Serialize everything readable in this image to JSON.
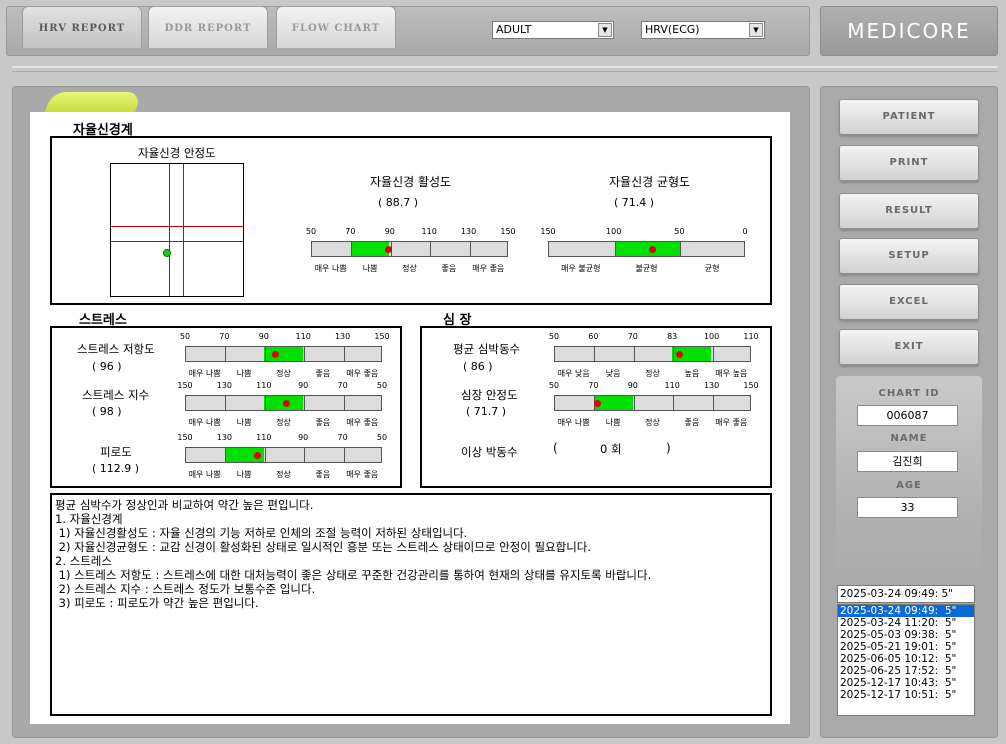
{
  "tabs": [
    {
      "label": "HRV  REPORT"
    },
    {
      "label": "DDR REPORT"
    },
    {
      "label": "FLOW  CHART"
    }
  ],
  "selects": {
    "population": "ADULT",
    "mode": "HRV(ECG)"
  },
  "brand": "MEDICORE",
  "autonomic": {
    "title": "자율신경계",
    "stability_title": "자율신경 안정도",
    "activity": {
      "title": "자율신경 활성도",
      "value_text": "(     88.7     )",
      "value": 88.7,
      "ticks": [
        "50",
        "70",
        "90",
        "110",
        "130",
        "150"
      ],
      "labels": [
        "매우 나쁨",
        "나쁨",
        "정상",
        "좋음",
        "매우 좋음"
      ]
    },
    "balance": {
      "title": "자율신경 균형도",
      "value_text": "(     71.4     )",
      "value": 71.4,
      "ticks": [
        "150",
        "100",
        "50",
        "0"
      ],
      "labels": [
        "매우 불균형",
        "불균형",
        "균형"
      ]
    }
  },
  "stress": {
    "title": "스트레스",
    "resistance": {
      "label": "스트레스 저항도",
      "value_text": "(     96     )",
      "value": 96,
      "ticks": [
        "50",
        "70",
        "90",
        "110",
        "130",
        "150"
      ],
      "labels": [
        "매우 나쁨",
        "나쁨",
        "정상",
        "좋음",
        "매우 좋음"
      ]
    },
    "index": {
      "label": "스트레스 지수",
      "value_text": "(     98     )",
      "value": 98,
      "ticks": [
        "150",
        "130",
        "110",
        "90",
        "70",
        "50"
      ],
      "labels": [
        "매우 나쁨",
        "나쁨",
        "정상",
        "좋음",
        "매우 좋음"
      ]
    },
    "fatigue": {
      "label": "피로도",
      "value_text": "( 112.9  )",
      "value": 112.9,
      "ticks": [
        "150",
        "130",
        "110",
        "90",
        "70",
        "50"
      ],
      "labels": [
        "매우 나쁨",
        "나쁨",
        "정상",
        "좋음",
        "매우 좋음"
      ]
    }
  },
  "heart": {
    "title": "심  장",
    "avg_hr": {
      "label": "평균 심박동수",
      "value_text": "(     86     )",
      "value": 86,
      "ticks": [
        "50",
        "60",
        "70",
        "83",
        "100",
        "110"
      ],
      "labels": [
        "매우 낮음",
        "낮음",
        "정상",
        "높음",
        "매우 높음"
      ]
    },
    "stability": {
      "label": "심장 안정도",
      "value_text": "(    71.7    )",
      "value": 71.7,
      "ticks": [
        "50",
        "70",
        "90",
        "110",
        "130",
        "150"
      ],
      "labels": [
        "매우 나쁨",
        "나쁨",
        "정상",
        "좋음",
        "매우 좋음"
      ]
    },
    "arrhythmia": {
      "label": "이상 박동수",
      "open": "(",
      "value_text": "0 회",
      "close": ")"
    }
  },
  "report_lines": [
    "평균 심박수가 정상인과 비교하여 약간 높은 편입니다.",
    "1. 자율신경계",
    " 1) 자율신경활성도 : 자율 신경의 기능 저하로 인체의 조절 능력이 저하된 상태입니다.",
    " 2) 자율신경균형도 : 교감 신경이 활성화된 상태로 일시적인 흥분 또는 스트레스 상태이므로 안정이 필요합니다.",
    "2. 스트레스",
    " 1) 스트레스 저항도 : 스트레스에 대한 대처능력이 좋은 상태로 꾸준한 건강관리를 통하여 현재의 상태를 유지토록 바랍니다.",
    " 2) 스트레스 지수 : 스트레스 정도가 보통수준 입니다.",
    " 3) 피로도 : 피로도가 약간 높은 편입니다."
  ],
  "side_buttons": [
    "PATIENT",
    "PRINT",
    "RESULT",
    "SETUP",
    "EXCEL",
    "EXIT"
  ],
  "patient": {
    "chart_id_label": "CHART ID",
    "chart_id": "006087",
    "name_label": "NAME",
    "name": "김진희",
    "age_label": "AGE",
    "age": "33"
  },
  "date_combo": "2025-03-24 09:49:  5\"",
  "date_list": [
    "2025-03-24 09:49:  5\"",
    "2025-03-24 11:20:  5\"",
    "2025-05-03 09:38:  5\"",
    "2025-05-21 19:01:  5\"",
    "2025-06-05 10:12:  5\"",
    "2025-06-25 17:52:  5\"",
    "2025-12-17 10:43:  5\"",
    "2025-12-17 10:51:  5\""
  ],
  "colors": {
    "fill": "#00e000",
    "marker": "#e00000",
    "selection": "#0a6ad6",
    "accent_tab": "#d8e94f"
  }
}
